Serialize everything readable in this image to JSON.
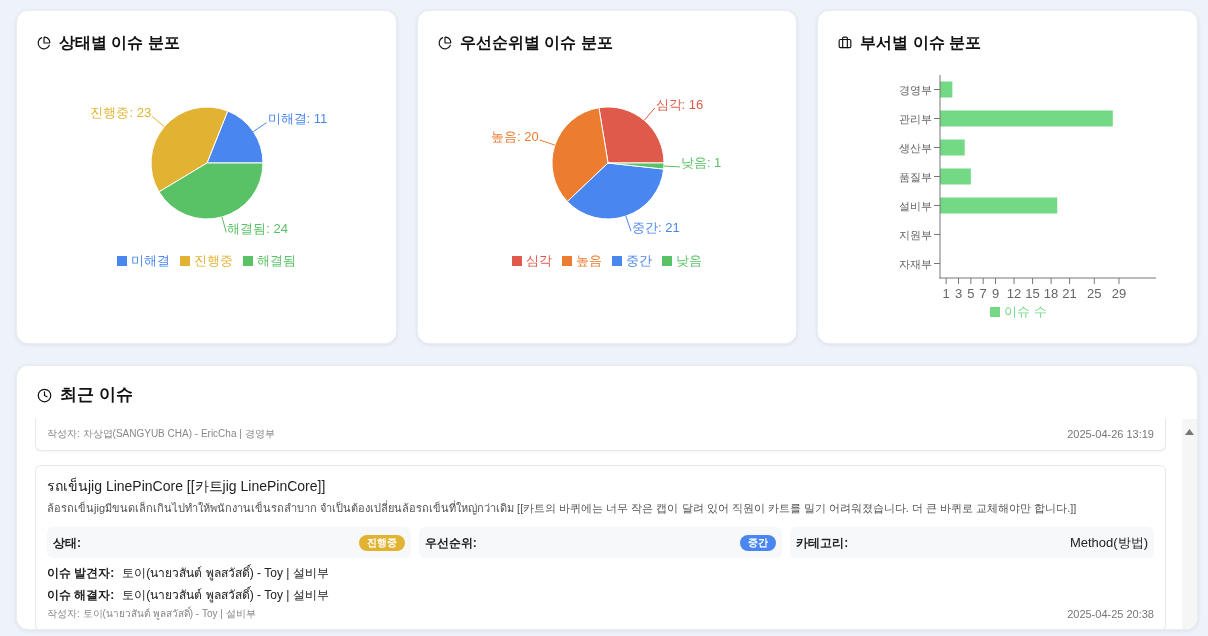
{
  "cards": [
    {
      "title": "상태별 이슈 분포",
      "chart_data": {
        "type": "pie",
        "categories": [
          "미해결",
          "진행중",
          "해결됨"
        ],
        "values": [
          11,
          23,
          24
        ],
        "colors": [
          "#4a86f0",
          "#e2b232",
          "#5ac266"
        ],
        "value_labels": [
          "미해결: 11",
          "진행중: 23",
          "해결됨: 24"
        ],
        "legend": "bottom"
      }
    },
    {
      "title": "우선순위별 이슈 분포",
      "chart_data": {
        "type": "pie",
        "categories": [
          "심각",
          "높음",
          "중간",
          "낮음"
        ],
        "values": [
          16,
          20,
          21,
          1
        ],
        "colors": [
          "#e05a4b",
          "#ec7c30",
          "#4a86f0",
          "#5ac266"
        ],
        "value_labels": [
          "심각: 16",
          "높음: 20",
          "중간: 21",
          "낮음: 1"
        ],
        "legend": "bottom"
      }
    },
    {
      "title": "부서별 이슈 분포",
      "chart_data": {
        "type": "bar",
        "orientation": "horizontal",
        "categories": [
          "경영부",
          "관리부",
          "생산부",
          "품질부",
          "설비부",
          "지원부",
          "자재부"
        ],
        "series": [
          {
            "name": "이슈 수",
            "color": "#74d985",
            "values": [
              2,
              28,
              4,
              5,
              19,
              0,
              0
            ]
          }
        ],
        "xlim": [
          0,
          35
        ],
        "xticks": [
          1,
          3,
          5,
          7,
          9,
          12,
          15,
          18,
          21,
          25,
          29
        ],
        "legend": "bottom"
      }
    }
  ],
  "recent_issues": {
    "title": "최근 이슈",
    "items": [
      {
        "author": "작성자: 차상엽(SANGYUB CHA) - EricCha | 경영부",
        "date": "2025-04-26 13:19"
      },
      {
        "title": "รถเข็นjig LinePinCore [[카트jig LinePinCore]]",
        "description": "ล้อรถเข็นjigมีขนดเล็กเกินไปทำให้พนักงานเข็นรถลำบาก จำเป็นต้องเปลี่ยนล้อรถเข็นที่ใหญ่กว่าเดิม [[카트의 바퀴에는 너무 작은 캡이 달려 있어 직원이 카트를 밀기 어려워졌습니다. 더 큰 바퀴로 교체해야만 합니다.]]",
        "fields": [
          {
            "kind": "badge",
            "label": "상태:",
            "value": "진행중",
            "color": "#e2b232"
          },
          {
            "kind": "badge",
            "label": "우선순위:",
            "value": "중간",
            "color": "#4a86f0"
          },
          {
            "kind": "text",
            "label": "카테고리:",
            "value": "Method(방법)"
          }
        ],
        "people": [
          {
            "label": "이슈 발견자:",
            "value": "토이(นายวสันต์ พูลสวัสดิ์) - Toy | 설비부"
          },
          {
            "label": "이슈 해결자:",
            "value": "토이(นายวสันต์ พูลสวัสดิ์) - Toy | 설비부"
          }
        ],
        "author": "작성자: 토이(นายวสันต์ พูลสวัสดิ์) - Toy | 설비부",
        "date": "2025-04-25 20:38"
      }
    ]
  }
}
